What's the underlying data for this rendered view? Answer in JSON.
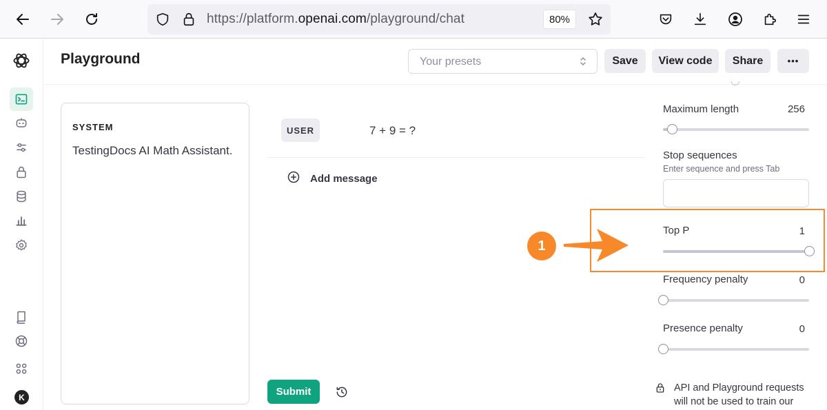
{
  "browser": {
    "url_prefix": "https://platform.",
    "url_domain": "openai.com",
    "url_path": "/playground/chat",
    "zoom": "80%"
  },
  "header": {
    "title": "Playground",
    "presets_placeholder": "Your presets",
    "save_label": "Save",
    "view_code_label": "View code",
    "share_label": "Share",
    "more_label": "•••"
  },
  "system": {
    "label": "SYSTEM",
    "text": "TestingDocs AI Math Assistant."
  },
  "messages": [
    {
      "role": "USER",
      "content": "7 + 9 = ?"
    }
  ],
  "add_message_label": "Add message",
  "submit_label": "Submit",
  "settings": {
    "max_length": {
      "label": "Maximum length",
      "value": "256",
      "level": 0.06
    },
    "stop_sequences": {
      "label": "Stop sequences",
      "hint": "Enter sequence and press Tab"
    },
    "top_p": {
      "label": "Top P",
      "value": "1",
      "level": 1.0
    },
    "frequency_penalty": {
      "label": "Frequency penalty",
      "value": "0",
      "level": 0.0
    },
    "presence_penalty": {
      "label": "Presence penalty",
      "value": "0",
      "level": 0.0
    }
  },
  "notice": "API and Playground requests will not be used to train our",
  "annotation": {
    "step": "1",
    "color": "#f7892b"
  },
  "user_initial": "K",
  "colors": {
    "accent": "#10a37f",
    "annotation": "#f7892b"
  }
}
